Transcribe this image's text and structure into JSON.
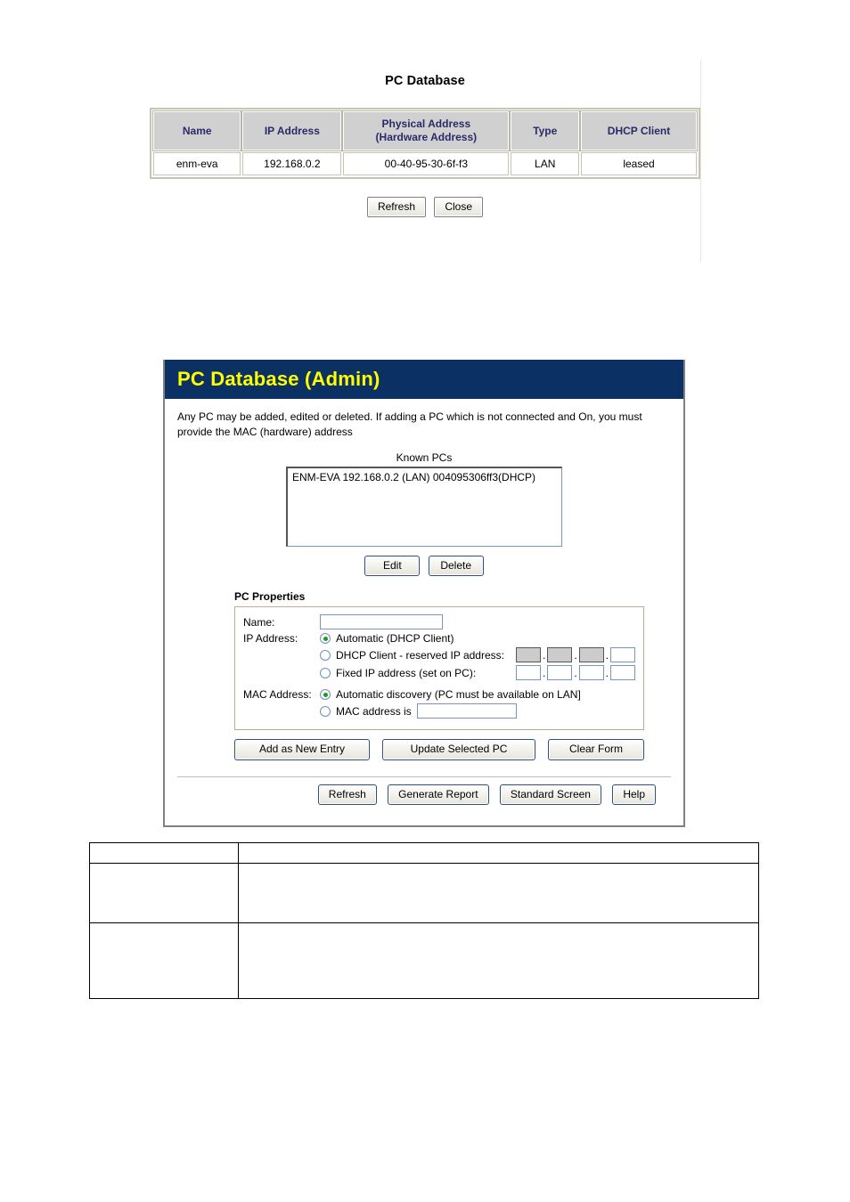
{
  "status_panel": {
    "title": "PC Database",
    "table": {
      "headers": [
        "Name",
        "IP Address",
        "Physical Address\n(Hardware Address)",
        "Type",
        "DHCP Client"
      ],
      "header_mac_line1": "Physical Address",
      "header_mac_line2": "(Hardware Address)",
      "rows": [
        {
          "name": "enm-eva",
          "ip_address": "192.168.0.2",
          "physical_address": "00-40-95-30-6f-f3",
          "type": "LAN",
          "dhcp_client": "leased"
        }
      ]
    },
    "buttons": {
      "refresh": "Refresh",
      "close": "Close"
    }
  },
  "admin_panel": {
    "header_title": "PC Database (Admin)",
    "header_bg": "#0b3064",
    "header_color": "#ffff00",
    "intro": "Any PC may be added, edited or deleted. If adding a PC which is not connected and On, you must provide the MAC (hardware) address",
    "known_pcs": {
      "label": "Known PCs",
      "items": [
        "ENM-EVA 192.168.0.2 (LAN) 004095306ff3(DHCP)"
      ],
      "edit_label": "Edit",
      "delete_label": "Delete"
    },
    "pc_properties": {
      "section_title": "PC Properties",
      "name_label": "Name:",
      "name_value": "",
      "ip_label": "IP Address:",
      "ip_options": [
        {
          "label": "Automatic (DHCP Client)",
          "selected": true
        },
        {
          "label": "DHCP Client - reserved IP address:",
          "selected": false
        },
        {
          "label": "Fixed IP address (set on PC):",
          "selected": false
        }
      ],
      "reserved_octets": [
        "",
        "",
        "",
        ""
      ],
      "fixed_octets": [
        "",
        "",
        "",
        ""
      ],
      "octet_separator": ".",
      "mac_label": "MAC Address:",
      "mac_options": [
        {
          "label": "Automatic discovery (PC must be available on LAN]",
          "selected": true
        },
        {
          "label": "MAC address is",
          "selected": false
        }
      ],
      "mac_value": ""
    },
    "action_buttons": {
      "add": "Add as New Entry",
      "update": "Update Selected PC",
      "clear": "Clear Form"
    },
    "footer_buttons": {
      "refresh": "Refresh",
      "generate_report": "Generate Report",
      "standard_screen": "Standard Screen",
      "help": "Help"
    }
  },
  "bottom_table": {
    "rows": [
      {
        "col1": "",
        "col2": ""
      },
      {
        "col1": "",
        "col2": ""
      },
      {
        "col1": "",
        "col2": ""
      }
    ]
  }
}
